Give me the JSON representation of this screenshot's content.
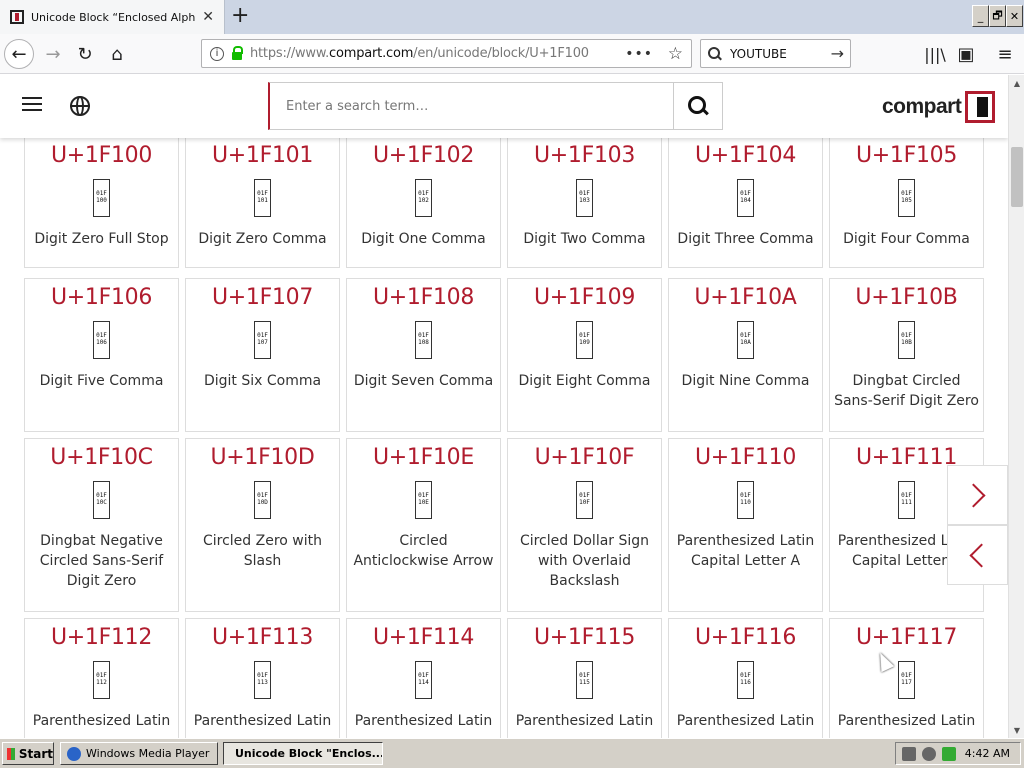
{
  "browser": {
    "tab_title": "Unicode Block “Enclosed Alphanum",
    "tab_close": "✕",
    "new_tab": "+",
    "url_prefix": "https://www.",
    "url_domain": "compart.com",
    "url_path": "/en/unicode/block/U+1F100",
    "search_text": "YOUTUBE",
    "window_buttons": [
      "_",
      "🗗",
      "✕"
    ]
  },
  "site": {
    "search_placeholder": "Enter a search term…",
    "logo_text": "compart"
  },
  "cards": [
    {
      "code": "U+1F100",
      "glyph": [
        "01F",
        "100"
      ],
      "name": "Digit Zero Full Stop"
    },
    {
      "code": "U+1F101",
      "glyph": [
        "01F",
        "101"
      ],
      "name": "Digit Zero Comma"
    },
    {
      "code": "U+1F102",
      "glyph": [
        "01F",
        "102"
      ],
      "name": "Digit One Comma"
    },
    {
      "code": "U+1F103",
      "glyph": [
        "01F",
        "103"
      ],
      "name": "Digit Two Comma"
    },
    {
      "code": "U+1F104",
      "glyph": [
        "01F",
        "104"
      ],
      "name": "Digit Three Comma"
    },
    {
      "code": "U+1F105",
      "glyph": [
        "01F",
        "105"
      ],
      "name": "Digit Four Comma"
    },
    {
      "code": "U+1F106",
      "glyph": [
        "01F",
        "106"
      ],
      "name": "Digit Five Comma"
    },
    {
      "code": "U+1F107",
      "glyph": [
        "01F",
        "107"
      ],
      "name": "Digit Six Comma"
    },
    {
      "code": "U+1F108",
      "glyph": [
        "01F",
        "108"
      ],
      "name": "Digit Seven Comma"
    },
    {
      "code": "U+1F109",
      "glyph": [
        "01F",
        "109"
      ],
      "name": "Digit Eight Comma"
    },
    {
      "code": "U+1F10A",
      "glyph": [
        "01F",
        "10A"
      ],
      "name": "Digit Nine Comma"
    },
    {
      "code": "U+1F10B",
      "glyph": [
        "01F",
        "10B"
      ],
      "name": "Dingbat Circled Sans-Serif Digit Zero"
    },
    {
      "code": "U+1F10C",
      "glyph": [
        "01F",
        "10C"
      ],
      "name": "Dingbat Negative Circled Sans-Serif Digit Zero"
    },
    {
      "code": "U+1F10D",
      "glyph": [
        "01F",
        "10D"
      ],
      "name": "Circled Zero with Slash"
    },
    {
      "code": "U+1F10E",
      "glyph": [
        "01F",
        "10E"
      ],
      "name": "Circled Anticlockwise Arrow"
    },
    {
      "code": "U+1F10F",
      "glyph": [
        "01F",
        "10F"
      ],
      "name": "Circled Dollar Sign with Overlaid Backslash"
    },
    {
      "code": "U+1F110",
      "glyph": [
        "01F",
        "110"
      ],
      "name": "Parenthesized Latin Capital Letter A"
    },
    {
      "code": "U+1F111",
      "glyph": [
        "01F",
        "111"
      ],
      "name": "Parenthesized Latin Capital Letter B"
    },
    {
      "code": "U+1F112",
      "glyph": [
        "01F",
        "112"
      ],
      "name": "Parenthesized Latin"
    },
    {
      "code": "U+1F113",
      "glyph": [
        "01F",
        "113"
      ],
      "name": "Parenthesized Latin"
    },
    {
      "code": "U+1F114",
      "glyph": [
        "01F",
        "114"
      ],
      "name": "Parenthesized Latin"
    },
    {
      "code": "U+1F115",
      "glyph": [
        "01F",
        "115"
      ],
      "name": "Parenthesized Latin"
    },
    {
      "code": "U+1F116",
      "glyph": [
        "01F",
        "116"
      ],
      "name": "Parenthesized Latin"
    },
    {
      "code": "U+1F117",
      "glyph": [
        "01F",
        "117"
      ],
      "name": "Parenthesized Latin"
    }
  ],
  "taskbar": {
    "start": "Start",
    "tasks": [
      "Windows Media Player",
      "Unicode Block \"Enclos..."
    ],
    "clock": "4:42 AM"
  },
  "colors": {
    "accent": "#b01c2e"
  }
}
